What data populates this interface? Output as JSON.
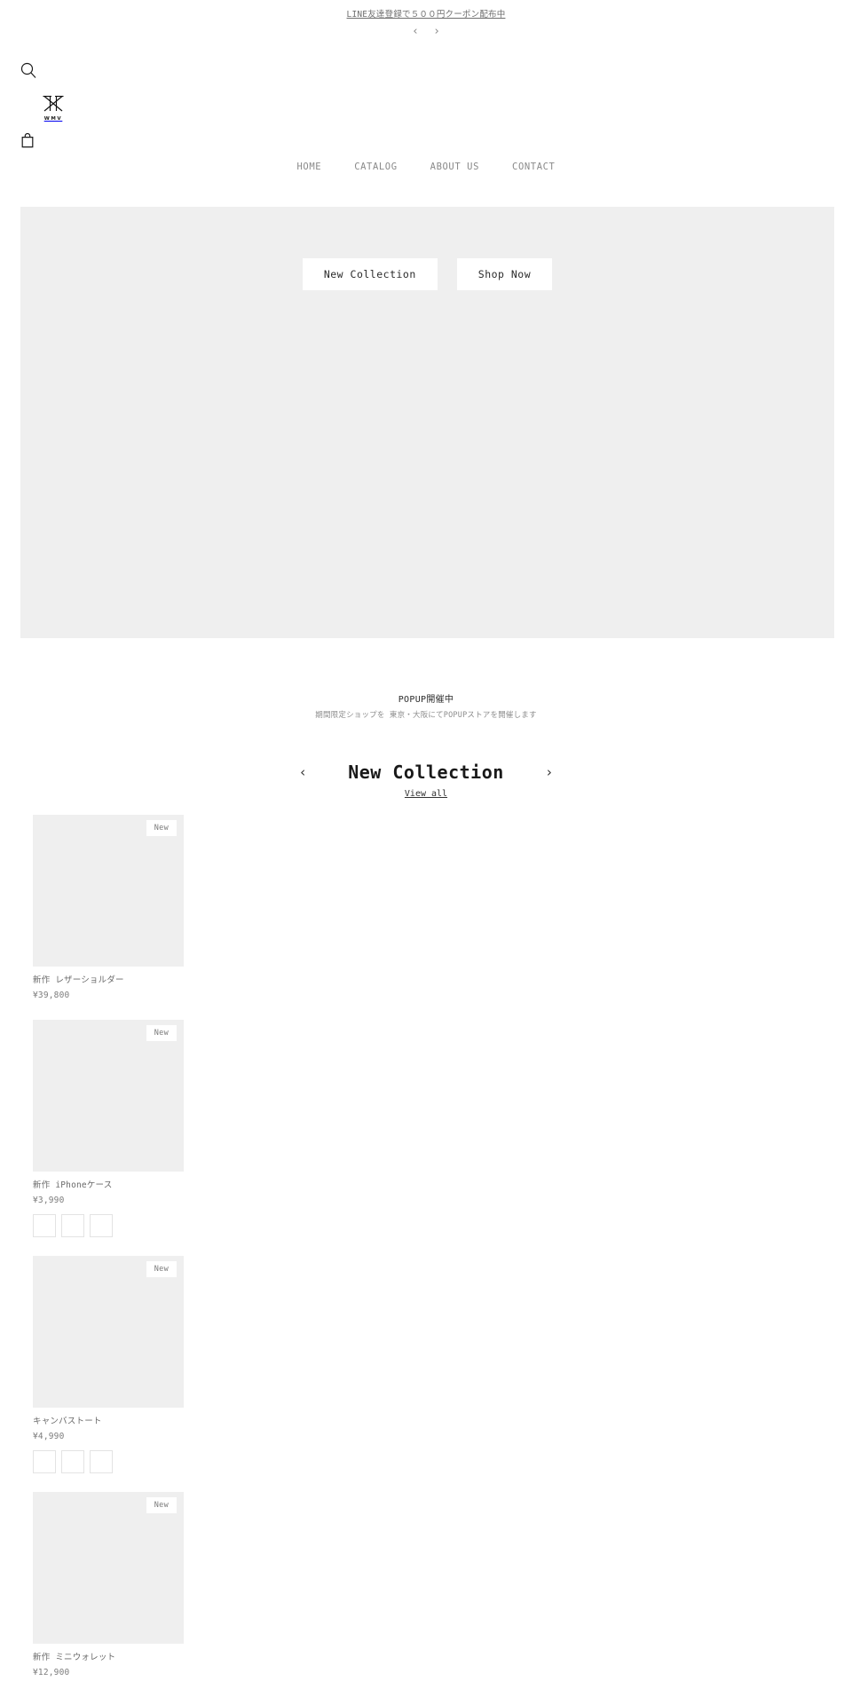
{
  "announcement": {
    "text": "LINE友達登録で５００円クーポン配布中",
    "prev_icon": "chevron-left-icon",
    "next_icon": "chevron-right-icon"
  },
  "header": {
    "search_icon": "search-icon",
    "cart_icon": "shopping-bag-icon",
    "logo_wordmark": "WMV",
    "nav": [
      {
        "label": "HOME"
      },
      {
        "label": "CATALOG"
      },
      {
        "label": "ABOUT US"
      },
      {
        "label": "CONTACT"
      }
    ]
  },
  "hero": {
    "buttons": [
      {
        "label": "New Collection"
      },
      {
        "label": "Shop Now"
      }
    ],
    "background_color": "#efefef"
  },
  "popup_section": {
    "title": "POPUP開催中",
    "subtitle": "期間限定ショップを 東京・大阪にてPOPUPストアを開催します"
  },
  "collection": {
    "title": "New Collection",
    "view_all": "View all",
    "prev_icon": "chevron-left-icon",
    "next_icon": "chevron-right-icon"
  },
  "products": [
    {
      "badge": "New",
      "title": "新作 レザーショルダー",
      "price": "¥39,800",
      "swatches": []
    },
    {
      "badge": "New",
      "title": "新作 iPhoneケース",
      "price": "¥3,990",
      "swatches": [
        "#ffffff",
        "#ffffff",
        "#ffffff"
      ]
    },
    {
      "badge": "New",
      "title": "キャンバストート",
      "price": "¥4,990",
      "swatches": [
        "#ffffff",
        "#ffffff",
        "#ffffff"
      ]
    },
    {
      "badge": "New",
      "title": "新作 ミニウォレット",
      "price": "¥12,900",
      "swatches": []
    }
  ]
}
